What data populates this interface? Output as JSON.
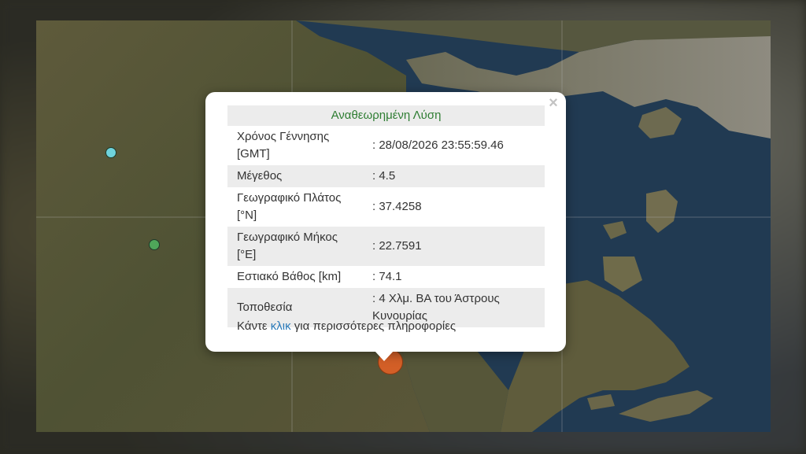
{
  "popup": {
    "header": "Αναθεωρημένη Λύση",
    "rows": [
      {
        "label": "Χρόνος Γέννησης [GMT]",
        "value": ": 28/08/2026 23:55:59.46"
      },
      {
        "label": "Μέγεθος",
        "value": ": 4.5"
      },
      {
        "label": "Γεωγραφικό Πλάτος [°N]",
        "value": ": 37.4258"
      },
      {
        "label": "Γεωγραφικό Μήκος [°E]",
        "value": ": 22.7591"
      },
      {
        "label": "Εστιακό Βάθος [km]",
        "value": ": 74.1"
      },
      {
        "label": "Τοποθεσία",
        "value": ": 4 Χλμ. ΒΑ του Άστρους Κυνουρίας"
      }
    ],
    "more_prefix": "Κάντε ",
    "more_link": "κλικ",
    "more_suffix": " για περισσότερες πληροφορίες",
    "close_label": "×"
  },
  "markers": {
    "colors": {
      "cyan": "#6fd3dc",
      "green": "#4fa65a",
      "orange": "#d35f27"
    }
  },
  "colors": {
    "sea": "#223a52",
    "land": "#5b5a3a",
    "header_text": "#2e7d32",
    "link": "#2a7ab9"
  }
}
